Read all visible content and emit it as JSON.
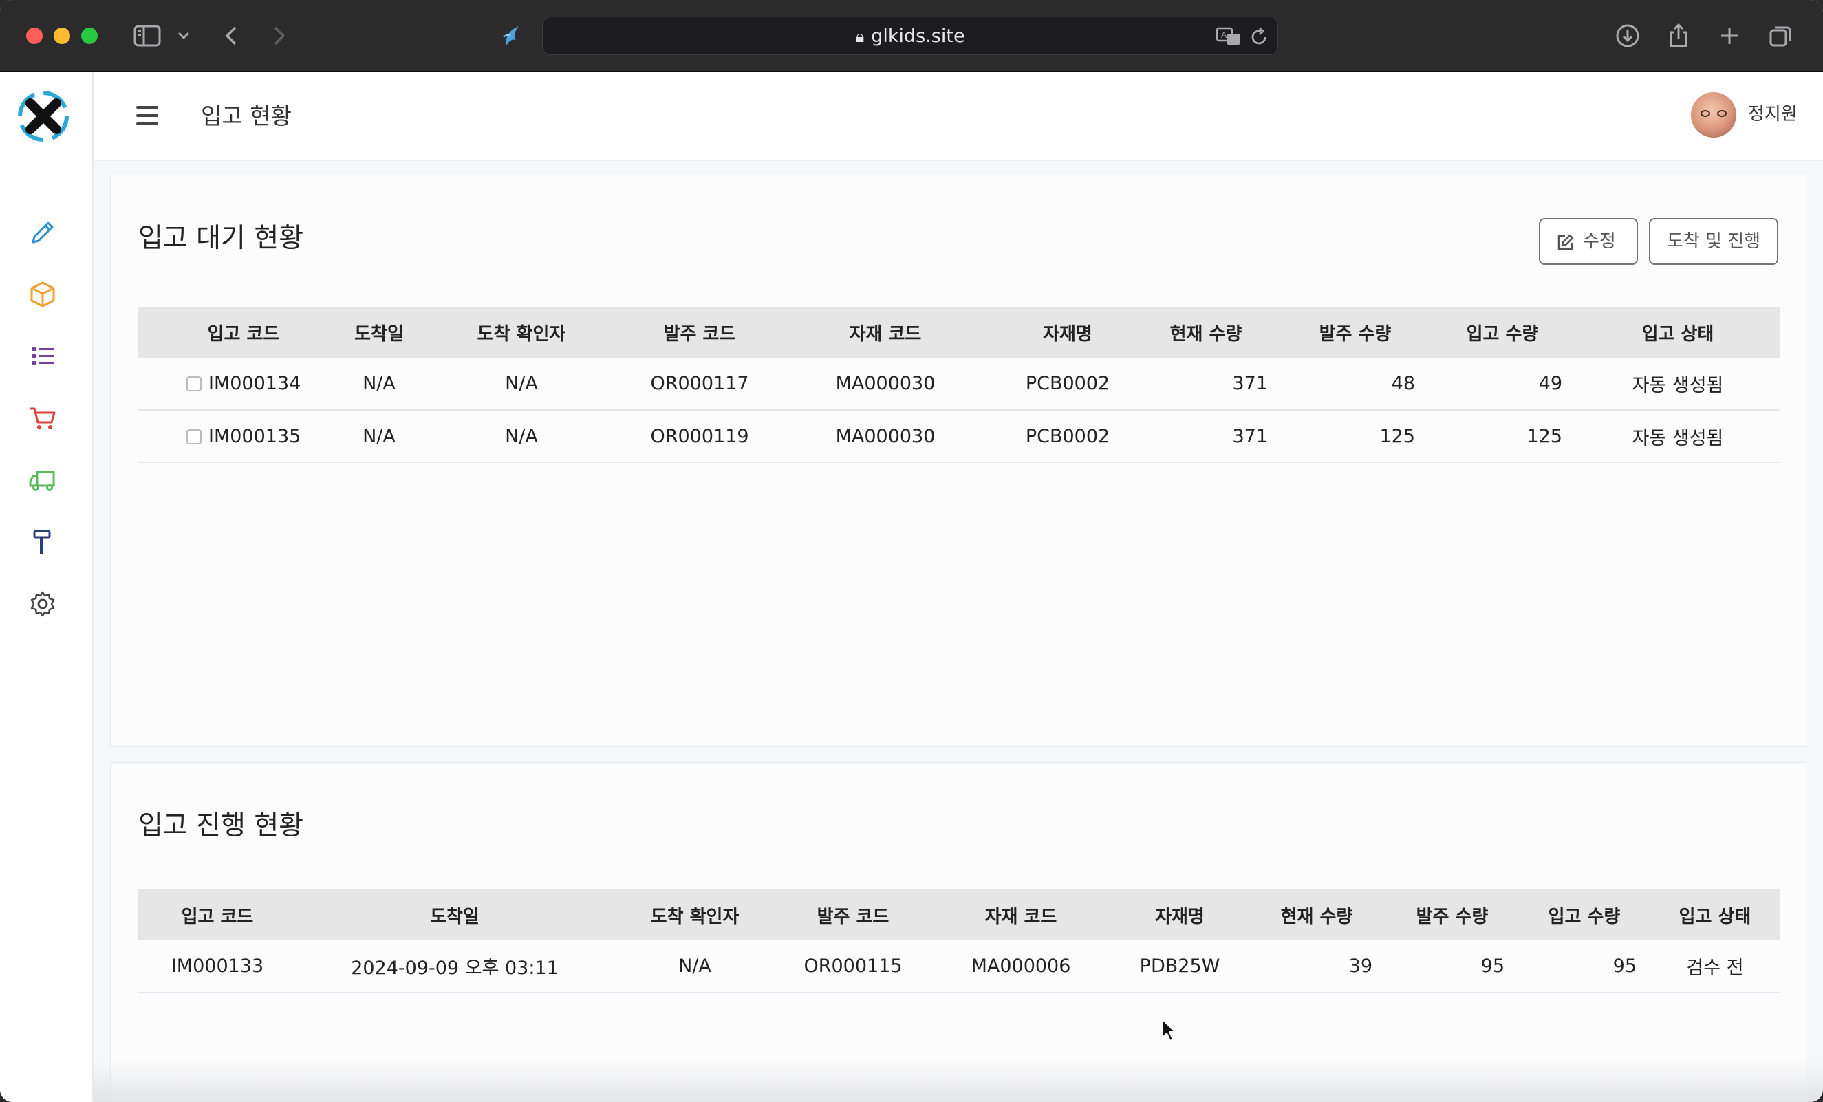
{
  "browser": {
    "url": "glkids.site"
  },
  "header": {
    "page_title": "입고 현황",
    "user_name": "정지원"
  },
  "sidebar": {
    "items": [
      {
        "icon": "pencil-icon",
        "color": "#2b8fd6"
      },
      {
        "icon": "box-icon",
        "color": "#f0a030"
      },
      {
        "icon": "list-icon",
        "color": "#7b3fa0"
      },
      {
        "icon": "cart-icon",
        "color": "#e0403c"
      },
      {
        "icon": "truck-icon",
        "color": "#5cb85c"
      },
      {
        "icon": "hammer-icon",
        "color": "#2c3e7a"
      },
      {
        "icon": "gear-icon",
        "color": "#444444"
      }
    ]
  },
  "pending": {
    "title": "입고 대기 현황",
    "edit_label": "수정",
    "arrive_label": "도착 및 진행",
    "columns": [
      "입고 코드",
      "도착일",
      "도착 확인자",
      "발주 코드",
      "자재 코드",
      "자재명",
      "현재 수량",
      "발주 수량",
      "입고 수량",
      "입고 상태"
    ],
    "rows": [
      {
        "code": "IM000134",
        "arrival": "N/A",
        "checker": "N/A",
        "order_code": "OR000117",
        "material_code": "MA000030",
        "material_name": "PCB0002",
        "current_qty": "371",
        "order_qty": "48",
        "in_qty": "49",
        "status": "자동 생성됨"
      },
      {
        "code": "IM000135",
        "arrival": "N/A",
        "checker": "N/A",
        "order_code": "OR000119",
        "material_code": "MA000030",
        "material_name": "PCB0002",
        "current_qty": "371",
        "order_qty": "125",
        "in_qty": "125",
        "status": "자동 생성됨"
      }
    ]
  },
  "progress": {
    "title": "입고 진행 현황",
    "columns": [
      "입고 코드",
      "도착일",
      "도착 확인자",
      "발주 코드",
      "자재 코드",
      "자재명",
      "현재 수량",
      "발주 수량",
      "입고 수량",
      "입고 상태"
    ],
    "rows": [
      {
        "code": "IM000133",
        "arrival": "2024-09-09 오후 03:11",
        "checker": "N/A",
        "order_code": "OR000115",
        "material_code": "MA000006",
        "material_name": "PDB25W",
        "current_qty": "39",
        "order_qty": "95",
        "in_qty": "95",
        "status": "검수 전"
      }
    ]
  }
}
